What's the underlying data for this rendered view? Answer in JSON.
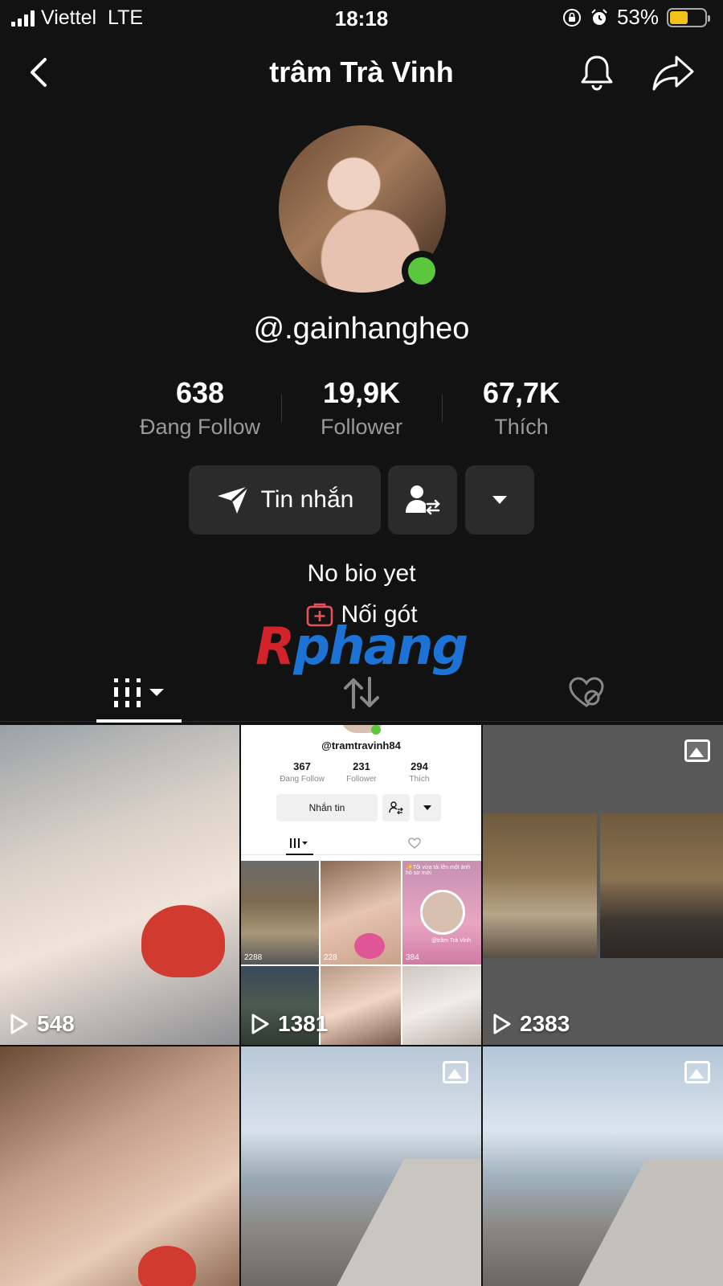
{
  "status_bar": {
    "carrier": "Viettel",
    "network": "LTE",
    "time": "18:18",
    "battery": "53%",
    "battery_level": 0.53,
    "colors": {
      "battery_fill": "#f2c21b"
    }
  },
  "nav": {
    "title": "trâm Trà Vinh",
    "icons": [
      "chevron-left-icon",
      "bell-icon",
      "share-icon"
    ]
  },
  "profile": {
    "username": "@.gainhangheo",
    "online": true,
    "stats": [
      {
        "value": "638",
        "label": "Đang Follow"
      },
      {
        "value": "19,9K",
        "label": "Follower"
      },
      {
        "value": "67,7K",
        "label": "Thích"
      }
    ],
    "message_button": "Tin nhắn",
    "bio": "No bio yet",
    "link_label": "Nối gót",
    "colors": {
      "online": "#5ac73c",
      "link_icon": "#e8505b"
    }
  },
  "watermark": {
    "first": "R",
    "rest": "phang"
  },
  "tabs": [
    {
      "icon": "grid-icon",
      "active": true
    },
    {
      "icon": "repost-icon",
      "active": false
    },
    {
      "icon": "liked-hidden-icon",
      "active": false
    }
  ],
  "videos": [
    {
      "views": "548",
      "type": "video"
    },
    {
      "views": "1381",
      "type": "video"
    },
    {
      "views": "2383",
      "type": "photo"
    },
    {
      "views": "",
      "type": "video"
    },
    {
      "views": "",
      "type": "photo"
    },
    {
      "views": "",
      "type": "photo"
    }
  ],
  "embedded_screenshot": {
    "username": "@tramtravinh84",
    "stats": [
      {
        "value": "367",
        "label": "Đang Follow"
      },
      {
        "value": "231",
        "label": "Follower"
      },
      {
        "value": "294",
        "label": "Thích"
      }
    ],
    "message_button": "Nhắn tin",
    "counts": [
      "2288",
      "228",
      "384"
    ],
    "caption": "✨Tôi vừa tải lên một ảnh hồ sơ mới",
    "sticker_label": "@trâm Trà Vinh"
  }
}
